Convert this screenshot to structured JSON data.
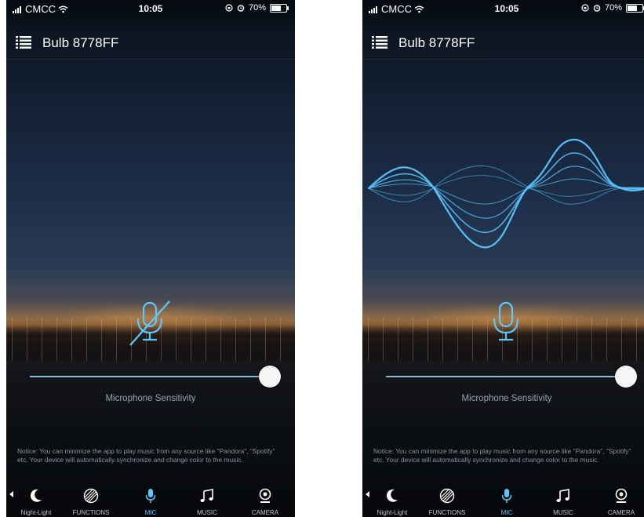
{
  "colors": {
    "accent": "#5ac8ff",
    "text": "#ffffff",
    "muted": "#9aa2ab"
  },
  "status_bar": {
    "carrier": "CMCC",
    "time": "10:05",
    "battery": "70%",
    "battery_level": 0.7
  },
  "header": {
    "title": "Bulb 8778FF",
    "menu_icon": "list-menu-icon"
  },
  "screens": [
    {
      "state": "microphone-off",
      "mic_icon": "mic-muted-icon",
      "waveform_visible": false
    },
    {
      "state": "microphone-on",
      "mic_icon": "mic-icon",
      "waveform_visible": true
    }
  ],
  "slider": {
    "label": "Microphone Sensitivity",
    "value": 1.0
  },
  "notice": "Notice: You can minimize the app to play music from any source like \"Pandora\", \"Spotify\" etc. Your device will automatically synchronize and change color to the music.",
  "tabs": [
    {
      "label": "Night-Light",
      "icon": "moon-icon",
      "active": false
    },
    {
      "label": "FUNCTIONS",
      "icon": "functions-disc-icon",
      "active": false
    },
    {
      "label": "MIC",
      "icon": "mic-icon",
      "active": true
    },
    {
      "label": "MUSIC",
      "icon": "music-note-icon",
      "active": false
    },
    {
      "label": "CAMERA",
      "icon": "camera-icon",
      "active": false
    }
  ]
}
